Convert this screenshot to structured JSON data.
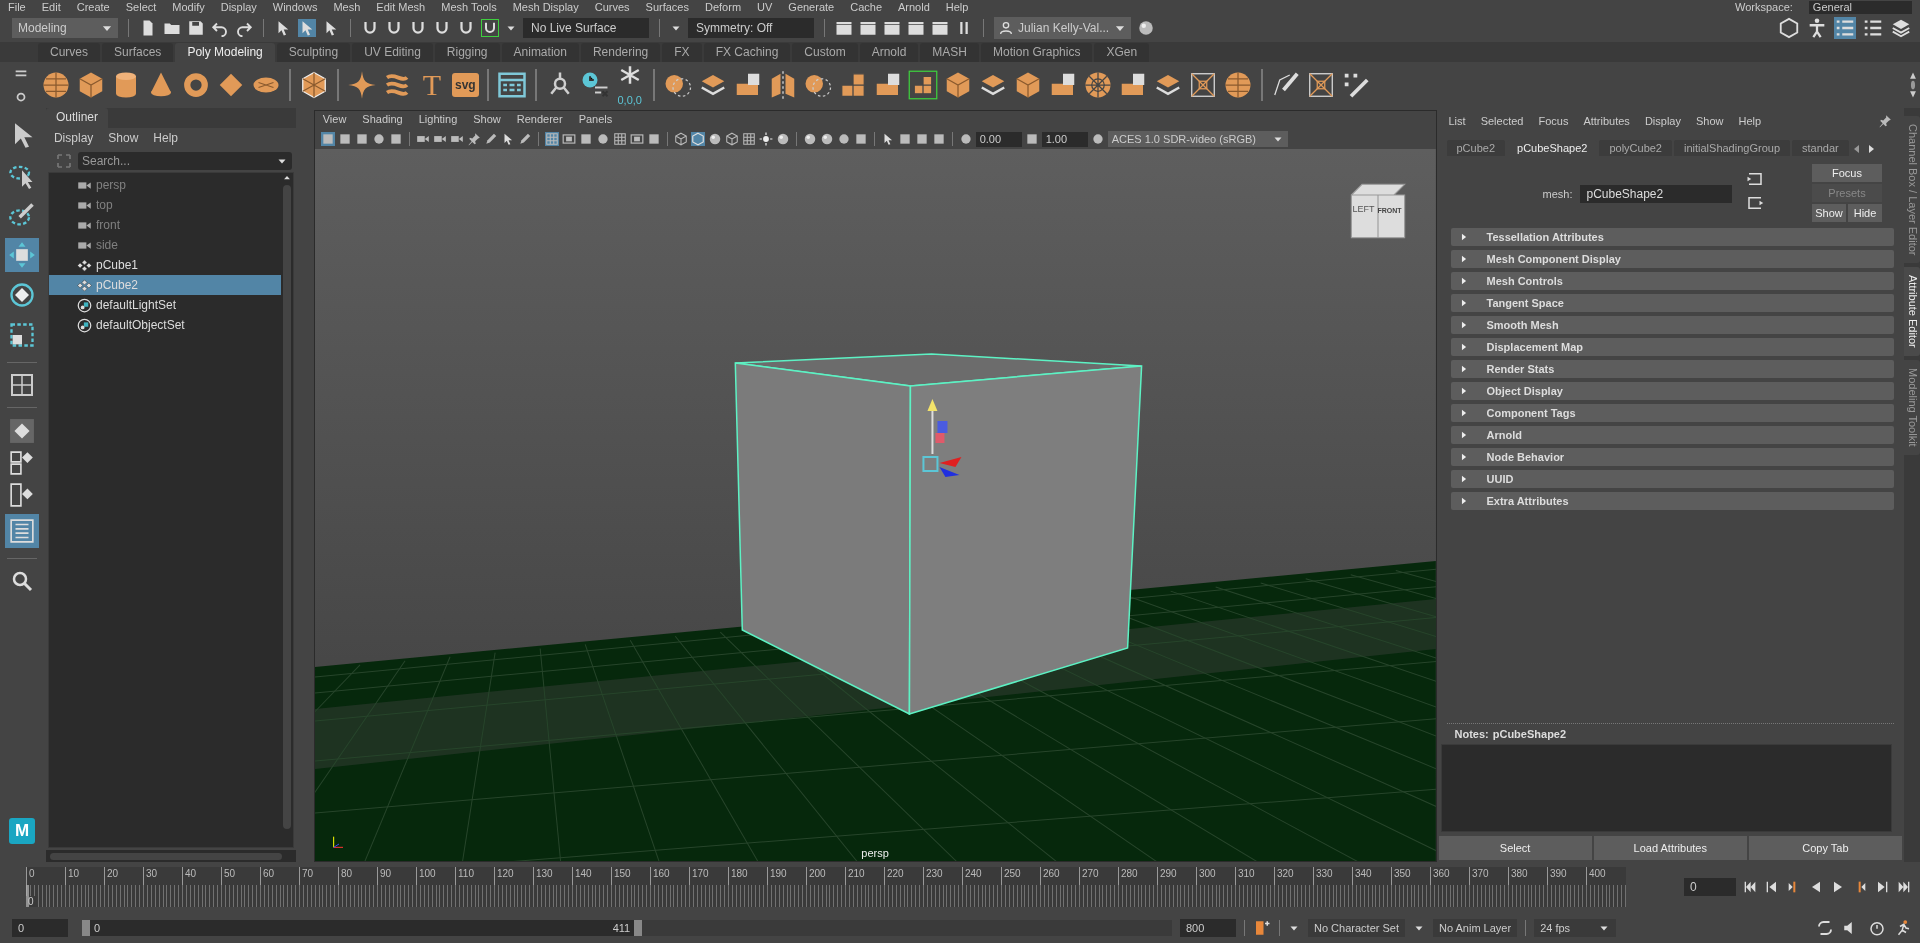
{
  "menu_bar": {
    "items": [
      "File",
      "Edit",
      "Create",
      "Select",
      "Modify",
      "Display",
      "Windows",
      "Mesh",
      "Edit Mesh",
      "Mesh Tools",
      "Mesh Display",
      "Curves",
      "Surfaces",
      "Deform",
      "UV",
      "Generate",
      "Cache",
      "Arnold",
      "Help"
    ],
    "workspace_label": "Workspace:",
    "workspace": "General"
  },
  "status_line": {
    "menu_set": "Modeling",
    "live_surface": "No Live Surface",
    "symmetry": "Symmetry: Off",
    "account": "Julian Kelly-Val..."
  },
  "shelf": {
    "tabs": [
      {
        "label": "Curves",
        "selected": false
      },
      {
        "label": "Surfaces",
        "selected": false
      },
      {
        "label": "Poly Modeling",
        "selected": true
      },
      {
        "label": "Sculpting",
        "selected": false
      },
      {
        "label": "UV Editing",
        "selected": false
      },
      {
        "label": "Rigging",
        "selected": false
      },
      {
        "label": "Animation",
        "selected": false
      },
      {
        "label": "Rendering",
        "selected": false
      },
      {
        "label": "FX",
        "selected": false
      },
      {
        "label": "FX Caching",
        "selected": false
      },
      {
        "label": "Custom",
        "selected": false
      },
      {
        "label": "Arnold",
        "selected": false
      },
      {
        "label": "MASH",
        "selected": false
      },
      {
        "label": "Motion Graphics",
        "selected": false
      },
      {
        "label": "XGen",
        "selected": false
      }
    ],
    "text_icons": [
      "T",
      "svg"
    ],
    "freeze_label": "0,0,0"
  },
  "toolbox": {
    "tools": [
      {
        "kind": "select",
        "selected": false
      },
      {
        "kind": "lasso",
        "selected": false
      },
      {
        "kind": "paint",
        "selected": false
      },
      {
        "kind": "move",
        "selected": true
      },
      {
        "kind": "rotate",
        "selected": false
      },
      {
        "kind": "scale",
        "selected": false
      }
    ],
    "logo": "M"
  },
  "outliner": {
    "title": "Outliner",
    "menus": [
      "Display",
      "Show",
      "Help"
    ],
    "search": {
      "placeholder": "Search..."
    },
    "items": [
      {
        "label": "persp",
        "kind": "camera",
        "hidden": true,
        "selected": false
      },
      {
        "label": "top",
        "kind": "camera",
        "hidden": true,
        "selected": false
      },
      {
        "label": "front",
        "kind": "camera",
        "hidden": true,
        "selected": false
      },
      {
        "label": "side",
        "kind": "camera",
        "hidden": true,
        "selected": false
      },
      {
        "label": "pCube1",
        "kind": "mesh",
        "hidden": false,
        "selected": false
      },
      {
        "label": "pCube2",
        "kind": "mesh",
        "hidden": false,
        "selected": true
      },
      {
        "label": "defaultLightSet",
        "kind": "set",
        "hidden": false,
        "selected": false
      },
      {
        "label": "defaultObjectSet",
        "kind": "set",
        "hidden": false,
        "selected": false
      }
    ]
  },
  "viewport": {
    "menus": [
      "View",
      "Shading",
      "Lighting",
      "Show",
      "Renderer",
      "Panels"
    ],
    "exposure": "0.00",
    "gamma": "1.00",
    "color_space": "ACES 1.0 SDR-video (sRGB)",
    "view_cube": [
      "LEFT",
      "FRONT"
    ],
    "camera_label": "persp"
  },
  "attribute_editor": {
    "menus": [
      "List",
      "Selected",
      "Focus",
      "Attributes",
      "Display",
      "Show",
      "Help"
    ],
    "tabs": [
      {
        "label": "pCube2",
        "selected": false
      },
      {
        "label": "pCubeShape2",
        "selected": true
      },
      {
        "label": "polyCube2",
        "selected": false
      },
      {
        "label": "initialShadingGroup",
        "selected": false
      },
      {
        "label": "standar",
        "selected": false
      }
    ],
    "node_label": "mesh:",
    "node_name": "pCubeShape2",
    "buttons": [
      {
        "label": "Focus",
        "disabled": false
      },
      {
        "label": "Presets",
        "disabled": true
      },
      {
        "label": "Show",
        "disabled": false
      },
      {
        "label": "Hide",
        "disabled": false
      }
    ],
    "sections": [
      {
        "label": "Tessellation Attributes",
        "expanded": false
      },
      {
        "label": "Mesh Component Display",
        "expanded": false
      },
      {
        "label": "Mesh Controls",
        "expanded": false
      },
      {
        "label": "Tangent Space",
        "expanded": false
      },
      {
        "label": "Smooth Mesh",
        "expanded": false
      },
      {
        "label": "Displacement Map",
        "expanded": false
      },
      {
        "label": "Render Stats",
        "expanded": false
      },
      {
        "label": "Object Display",
        "expanded": false
      },
      {
        "label": "Component Tags",
        "expanded": false
      },
      {
        "label": "Arnold",
        "expanded": false
      },
      {
        "label": "Node Behavior",
        "expanded": false
      },
      {
        "label": "UUID",
        "expanded": false
      },
      {
        "label": "Extra Attributes",
        "expanded": false
      }
    ],
    "notes_label": "Notes:",
    "notes_node": "pCubeShape2",
    "footer_buttons": [
      "Select",
      "Load Attributes",
      "Copy Tab"
    ]
  },
  "side_tabs": [
    {
      "label": "Channel Box / Layer Editor",
      "selected": false
    },
    {
      "label": "Attribute Editor",
      "selected": true
    },
    {
      "label": "Modeling Toolkit",
      "selected": false
    }
  ],
  "time_slider": {
    "ticks": [
      "0",
      "10",
      "20",
      "30",
      "40",
      "50",
      "60",
      "70",
      "80",
      "90",
      "100",
      "110",
      "120",
      "130",
      "140",
      "150",
      "160",
      "170",
      "180",
      "190",
      "200",
      "210",
      "220",
      "230",
      "240",
      "250",
      "260",
      "270",
      "280",
      "290",
      "300",
      "310",
      "320",
      "330",
      "340",
      "350",
      "360",
      "370",
      "380",
      "390",
      "400"
    ],
    "current_frame": "0",
    "frame_field": "0",
    "level": 0
  },
  "range_slider": {
    "start": "0",
    "range_start": "0",
    "range_end": "411",
    "end": "800",
    "level": 0.514,
    "character_set": "No Character Set",
    "anim_layer": "No Anim Layer",
    "fps": "24 fps"
  }
}
